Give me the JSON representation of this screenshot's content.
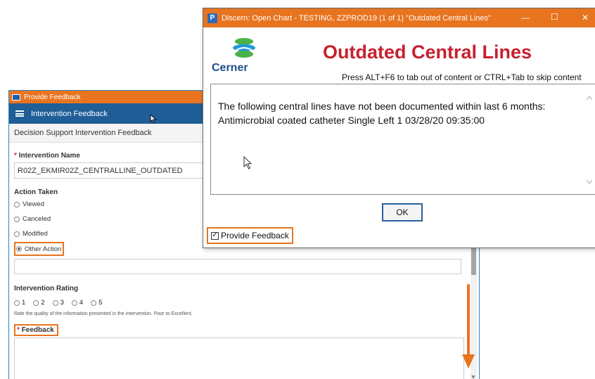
{
  "feedback": {
    "window_title": "Provide Feedback",
    "header_title": "Intervention Feedback",
    "subheader": "Decision Support Intervention Feedback",
    "intervention_name_label": "Intervention Name",
    "intervention_name_value": "R02Z_EKMIR02Z_CENTRALLINE_OUTDATED",
    "action_taken_label": "Action Taken",
    "actions": [
      {
        "label": "Viewed",
        "selected": false
      },
      {
        "label": "Canceled",
        "selected": false
      },
      {
        "label": "Modified",
        "selected": false
      },
      {
        "label": "Other Action",
        "selected": true
      }
    ],
    "other_action_value": "",
    "rating_label": "Intervention Rating",
    "ratings": [
      "1",
      "2",
      "3",
      "4",
      "5"
    ],
    "rating_hint": "Rate the quality of the information presented in the intervention. Poor to Excellent.",
    "feedback_label": "Feedback",
    "feedback_value": ""
  },
  "dialog": {
    "title": "Discern: Open Chart - TESTING, ZZPROD19 (1 of 1) \"Outdated Central Lines\"",
    "logo_text": "Cerner",
    "heading": "Outdated Central Lines",
    "hint": "Press ALT+F6 to tab out of content or CTRL+Tab to skip content",
    "line1": "The following central lines have not been documented within last 6 months:",
    "line2": "Antimicrobial coated catheter Single Left 1 03/28/20 09:35:00",
    "ok_label": "OK",
    "provide_feedback_label": "Provide Feedback",
    "provide_feedback_checked": true
  },
  "colors": {
    "accent_orange": "#e8741f",
    "header_blue": "#1f5e97",
    "heading_red": "#c8202f"
  }
}
